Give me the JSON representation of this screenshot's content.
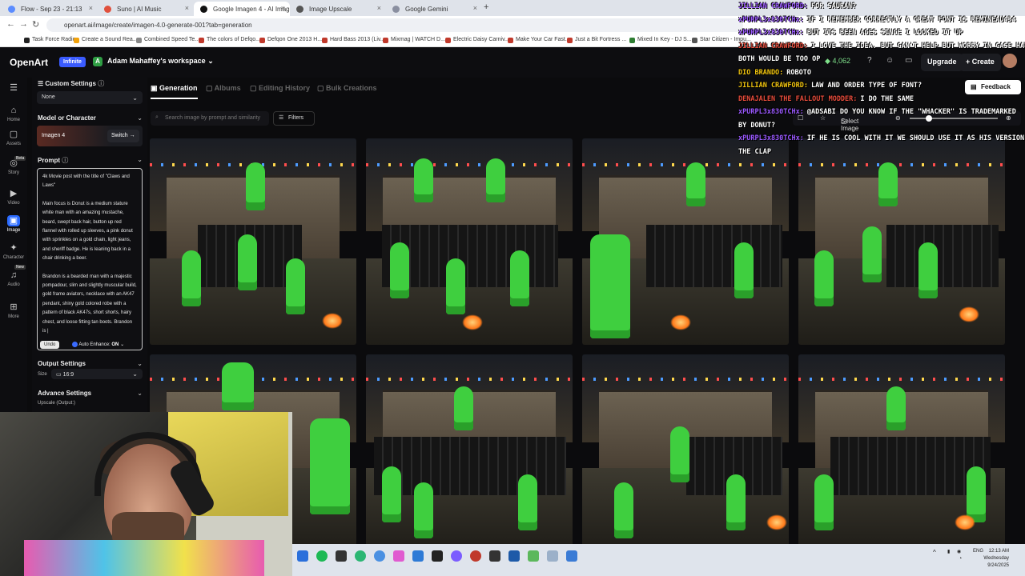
{
  "browser": {
    "tabs": [
      {
        "label": "Flow - Sep 23 - 21:13",
        "color": "#5b8cff"
      },
      {
        "label": "Suno | AI Music",
        "color": "#e0503c"
      },
      {
        "label": "Google Imagen 4 - AI Image G",
        "color": "#111111"
      },
      {
        "label": "Image Upscale",
        "color": "#555555"
      },
      {
        "label": "Google Gemini",
        "color": "#8a8fa0"
      }
    ],
    "url": "openart.ai/image/create/imagen-4.0-generate-001?tab=generation",
    "bookmarks": [
      {
        "label": "Task Force Radio",
        "color": "#222"
      },
      {
        "label": "Create a Sound Rea...",
        "color": "#f2a20b"
      },
      {
        "label": "Combined Speed Te...",
        "color": "#888"
      },
      {
        "label": "The colors of Defqo...",
        "color": "#c0392b"
      },
      {
        "label": "Defqon One 2013 H...",
        "color": "#c0392b"
      },
      {
        "label": "Hard Bass 2013 (Liv...",
        "color": "#c0392b"
      },
      {
        "label": "Mixmag | WATCH D...",
        "color": "#c0392b"
      },
      {
        "label": "Electric Daisy Carniv...",
        "color": "#c0392b"
      },
      {
        "label": "Make Your Car Fast...",
        "color": "#c0392b"
      },
      {
        "label": "Just a Bit Fortress ...",
        "color": "#c0392b"
      },
      {
        "label": "Mixed In Key - DJ S...",
        "color": "#2e7d32"
      },
      {
        "label": "Star Citizen - Impu...",
        "color": "#555"
      }
    ]
  },
  "header": {
    "logo": "OpenArt",
    "plan_badge": "Infinite",
    "workspace_initial": "A",
    "workspace": "Adam Mahaffey's workspace",
    "credits": "4,062",
    "upgrade": "Upgrade",
    "create": "Create",
    "feedback": "Feedback"
  },
  "rail": [
    {
      "label": "",
      "icon": "menu-icon"
    },
    {
      "label": "Home",
      "icon": "home-icon"
    },
    {
      "label": "Assets",
      "icon": "folder-icon"
    },
    {
      "label": "Story",
      "icon": "story-icon",
      "badge": "Beta"
    },
    {
      "label": "Video",
      "icon": "video-icon"
    },
    {
      "label": "Image",
      "icon": "image-icon",
      "active": true
    },
    {
      "label": "Character",
      "icon": "character-icon"
    },
    {
      "label": "Audio",
      "icon": "audio-icon",
      "badge": "New"
    },
    {
      "label": "More",
      "icon": "grid-icon"
    }
  ],
  "panel": {
    "custom_settings": "Custom Settings",
    "custom_value": "None",
    "model_header": "Model or Character",
    "model_name": "Imagen 4",
    "switch": "Switch",
    "prompt_header": "Prompt",
    "prompt_paragraphs": [
      "4k Movie post with the title of \"Claws and Laws\"",
      "Main focus is Donut is a medium stature white man with an amazing mustache, beard, swept back hair, button up red flannel with rolled up sleeves, a pink donut with sprinkles on a gold chain, light jeans, and sheriff badge. He is leaning back in a chair drinking a beer.",
      "Brandon is a bearded man with a majestic pompadour, slim and slightly muscular build, gold frame aviators, necklace with an AK47 pendant, shiny gold colored robe with a pattern of black AK47s, short shorts, hairy chest, and loose fitting tan boots. Brandon is |"
    ],
    "undo": "Undo",
    "auto_enhance_label": "Auto Enhance:",
    "auto_enhance_value": "ON",
    "output_header": "Output Settings",
    "size_label": "Size",
    "size_value": "16:9",
    "advance_header": "Advance Settings",
    "upscale_label": "Upscale (Output:)"
  },
  "main": {
    "tabs": [
      "Generation",
      "Albums",
      "Editing History",
      "Bulk Creations"
    ],
    "search_placeholder": "Search image by prompt and similarity",
    "filters": "Filters",
    "select_image": "Select Image"
  },
  "chat": [
    {
      "name": "JILLIAN CRAWFORD:",
      "msg": "FOR SAURAN?",
      "color": "#9b59ff"
    },
    {
      "name": "xPURPL3x830TCHx:",
      "msg": "IF I REMEMBER CORRECTLY A GREAT FONT IS REMINEAU434",
      "color": "#9b59ff"
    },
    {
      "name": "xPURPL3x830TCHx:",
      "msg": "BUT ITS BEEN AGES SINCE I LOOKED IT UP",
      "color": "#9b59ff"
    },
    {
      "name": "JILLIAN CRAWFORD:",
      "msg": "I LOVE THE IDEA. BUT CAN'T HELP BUT WORRY IN CASE HAVING",
      "color": "#e74c3c"
    },
    {
      "name": "",
      "msg": "BOTH WOULD BE TOO OP",
      "color": "#ffffff"
    },
    {
      "name": "DIO BRANDO:",
      "msg": "ROBOTO",
      "color": "#f1c40f"
    },
    {
      "name": "JILLIAN CRAWFORD:",
      "msg": "LAW AND ORDER TYPE OF FONT?",
      "color": "#f1c40f"
    },
    {
      "name": "DENAJALEN THE FALLOUT MODDER:",
      "msg": "I DO THE SAME",
      "color": "#e74c3c"
    },
    {
      "name": "xPURPL3x830TCHx:",
      "msg": "@ADSABI DO YOU KNOW IF THE \"WHACKER\" IS TRADEMARKED",
      "color": "#9b59ff"
    },
    {
      "name": "",
      "msg": "BY DONUT?",
      "color": "#ffffff"
    },
    {
      "name": "xPURPL3x830TCHx:",
      "msg": "IF HE IS COOL WITH IT WE SHOULD USE IT AS HIS VERSION OF",
      "color": "#9b59ff"
    },
    {
      "name": "",
      "msg": "THE CLAP",
      "color": "#ffffff"
    }
  ],
  "taskbar": {
    "lang": "ENG",
    "time": "12:13 AM",
    "day": "Wednesday",
    "date": "9/24/2025"
  }
}
